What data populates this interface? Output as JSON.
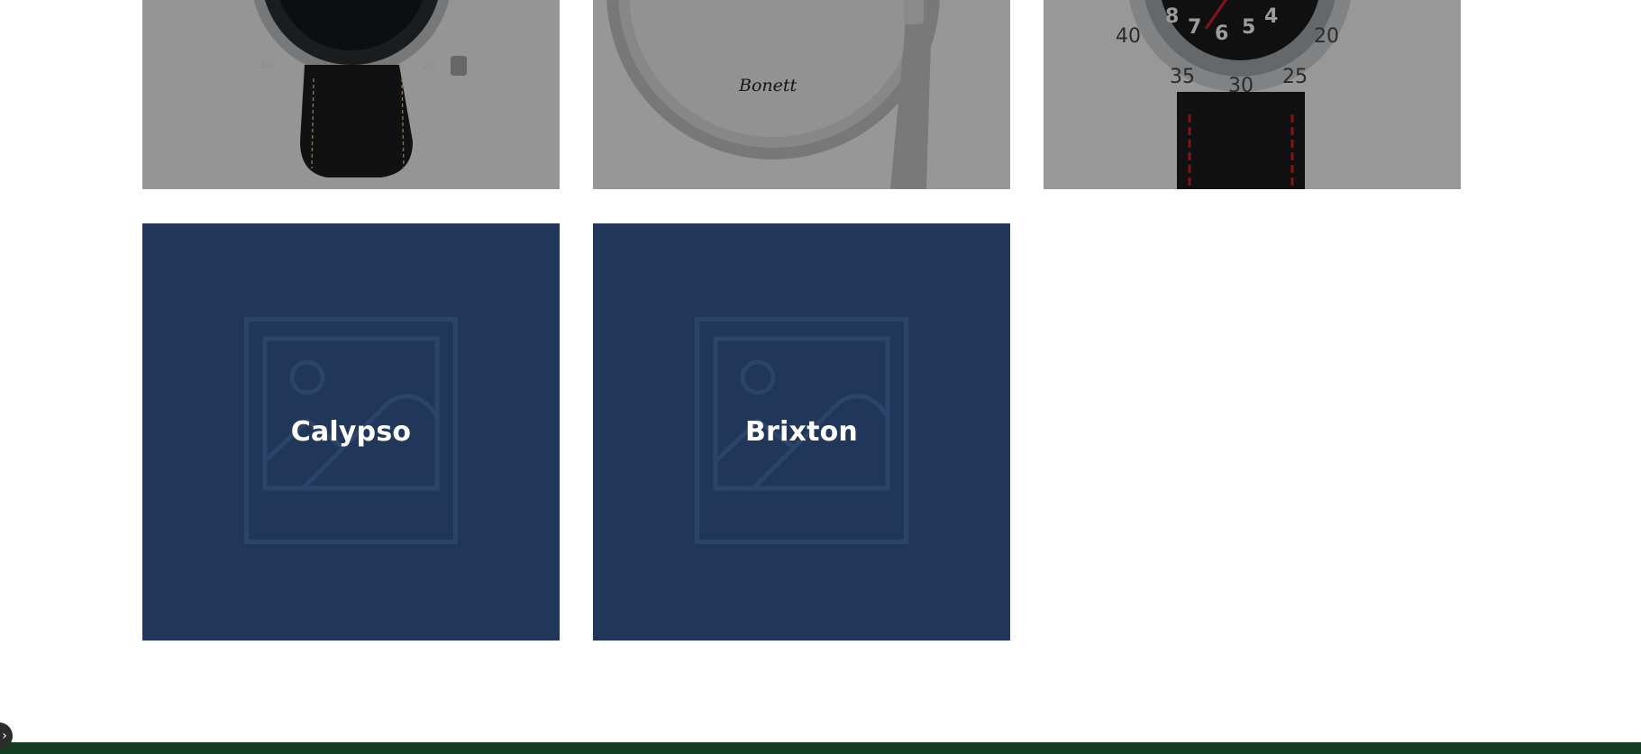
{
  "collections": [
    {
      "title": "",
      "image": "chronograph-watch-photo"
    },
    {
      "title": "",
      "image": "mantel-clock-photo"
    },
    {
      "title": "",
      "image": "diver-watch-photo"
    },
    {
      "title": "Calypso",
      "image": "image-placeholder-icon"
    },
    {
      "title": "Brixton",
      "image": "image-placeholder-icon"
    }
  ],
  "colors": {
    "placeholder_card": "#20375a",
    "footer": "#143d24",
    "photo_overlay": "#8f8f8f"
  },
  "footer": {},
  "floating_badge": {
    "icon": "chevron-icon"
  }
}
